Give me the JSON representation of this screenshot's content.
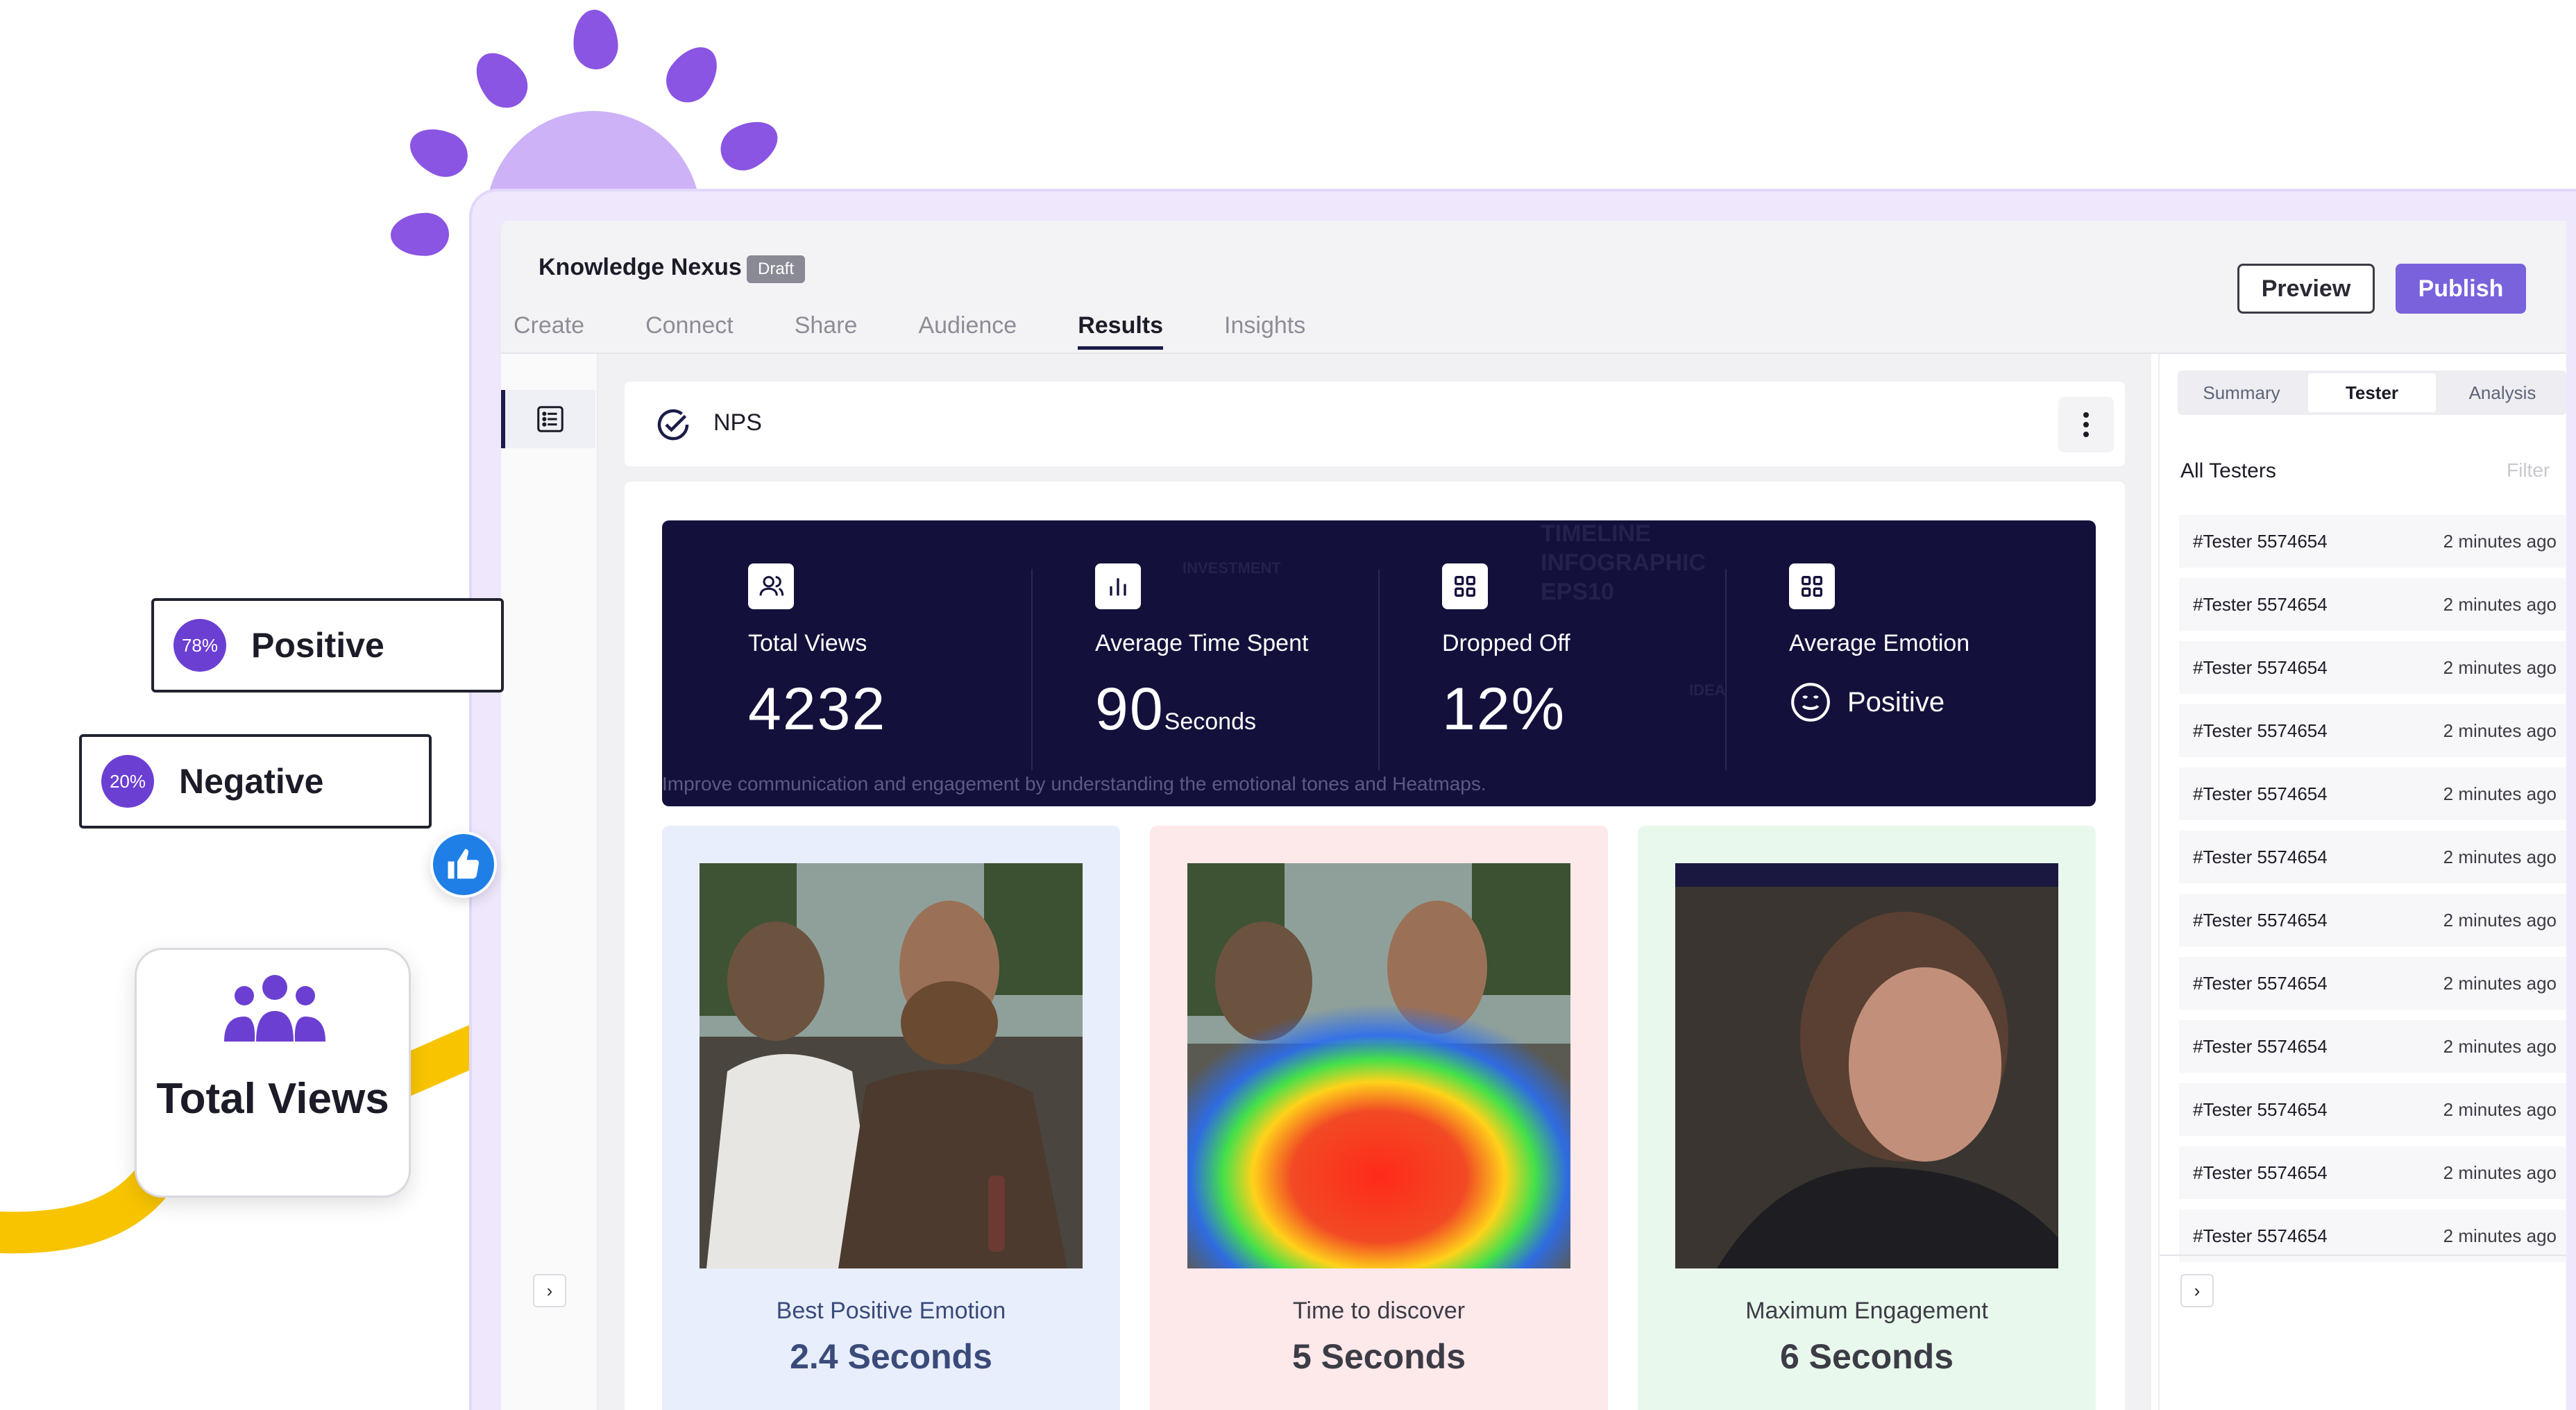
{
  "header": {
    "project_title": "Knowledge Nexus",
    "status_badge": "Draft",
    "preview_label": "Preview",
    "publish_label": "Publish",
    "tabs": [
      {
        "label": "Create",
        "active": false
      },
      {
        "label": "Connect",
        "active": false
      },
      {
        "label": "Share",
        "active": false
      },
      {
        "label": "Audience",
        "active": false
      },
      {
        "label": "Results",
        "active": true
      },
      {
        "label": "Insights",
        "active": false
      }
    ]
  },
  "section": {
    "title": "NPS"
  },
  "stats": {
    "total_views": {
      "label": "Total Views",
      "value": "4232"
    },
    "avg_time": {
      "label": "Average Time Spent",
      "value": "90",
      "unit": "Seconds"
    },
    "dropped_off": {
      "label": "Dropped Off",
      "value": "12%"
    },
    "avg_emotion": {
      "label": "Average Emotion",
      "value": "Positive"
    },
    "footer": "Improve communication and engagement by understanding the emotional tones and Heatmaps.",
    "background_words": [
      "INVESTMENT",
      "TIMELINE",
      "INFOGRAPHIC",
      "EPS10",
      "IDEA"
    ]
  },
  "cards": [
    {
      "caption": "Best Positive Emotion",
      "value": "2.4 Seconds",
      "bg": "#e8eefc",
      "color": "#3a4b7a"
    },
    {
      "caption": "Time to discover",
      "value": "5 Seconds",
      "bg": "#fde8ea",
      "color": "#3c3c46"
    },
    {
      "caption": "Maximum Engagement",
      "value": "6 Seconds",
      "bg": "#e9f8ec",
      "color": "#3c3c46"
    }
  ],
  "right_panel": {
    "tabs": [
      {
        "label": "Summary",
        "active": false
      },
      {
        "label": "Tester",
        "active": true
      },
      {
        "label": "Analysis",
        "active": false
      }
    ],
    "heading": "All Testers",
    "filter_label": "Filter",
    "testers": [
      {
        "name": "#Tester 5574654",
        "time": "2 minutes ago"
      },
      {
        "name": "#Tester 5574654",
        "time": "2 minutes ago"
      },
      {
        "name": "#Tester 5574654",
        "time": "2 minutes ago"
      },
      {
        "name": "#Tester 5574654",
        "time": "2 minutes ago"
      },
      {
        "name": "#Tester 5574654",
        "time": "2 minutes ago"
      },
      {
        "name": "#Tester 5574654",
        "time": "2 minutes ago"
      },
      {
        "name": "#Tester 5574654",
        "time": "2 minutes ago"
      },
      {
        "name": "#Tester 5574654",
        "time": "2 minutes ago"
      },
      {
        "name": "#Tester 5574654",
        "time": "2 minutes ago"
      },
      {
        "name": "#Tester 5574654",
        "time": "2 minutes ago"
      },
      {
        "name": "#Tester 5574654",
        "time": "2 minutes ago"
      },
      {
        "name": "#Tester 5574654",
        "time": "2 minutes ago"
      }
    ]
  },
  "floating": {
    "positive": {
      "percent": "78%",
      "label": "Positive"
    },
    "negative": {
      "percent": "20%",
      "label": "Negative"
    },
    "total_views_title": "Total Views"
  },
  "colors": {
    "accent": "#7a62dd",
    "dark_panel": "#13113b",
    "badge": "#6b3fd2"
  }
}
